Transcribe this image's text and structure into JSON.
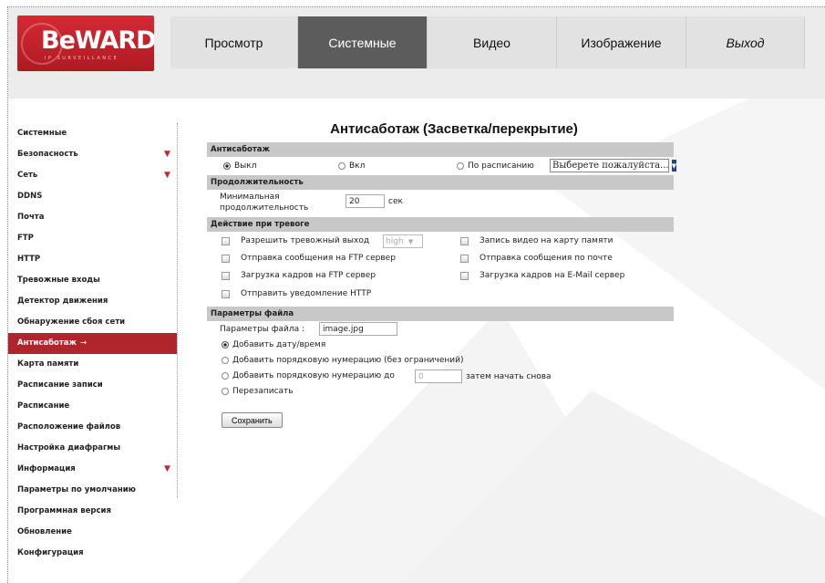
{
  "brand": {
    "name": "BeWARD",
    "tagline": "IP SURVEILLANCE"
  },
  "nav": [
    {
      "label": "Просмотр",
      "active": false
    },
    {
      "label": "Системные",
      "active": true
    },
    {
      "label": "Видео",
      "active": false
    },
    {
      "label": "Изображение",
      "active": false
    },
    {
      "label": "Выход",
      "active": false
    }
  ],
  "sidebar": [
    {
      "label": "Системные"
    },
    {
      "label": "Безопасность",
      "expand": true
    },
    {
      "label": "Сеть",
      "expand": true
    },
    {
      "label": "DDNS"
    },
    {
      "label": "Почта"
    },
    {
      "label": "FTP"
    },
    {
      "label": "HTTP"
    },
    {
      "label": "Тревожные входы"
    },
    {
      "label": "Детектор движения"
    },
    {
      "label": "Обнаружение сбоя сети"
    },
    {
      "label": "Антисаботаж",
      "active": true
    },
    {
      "label": "Карта памяти"
    },
    {
      "label": "Расписание записи"
    },
    {
      "label": "Расписание"
    },
    {
      "label": "Расположение файлов"
    },
    {
      "label": "Настройка диафрагмы"
    },
    {
      "label": "Информация",
      "expand": true
    },
    {
      "label": "Параметры по умолчанию"
    },
    {
      "label": "Программная версия"
    },
    {
      "label": "Обновление"
    },
    {
      "label": "Конфигурация"
    }
  ],
  "page": {
    "title": "Антисаботаж (Засветка/перекрытие)",
    "tamper": {
      "heading": "Антисаботаж",
      "off_label": "Выкл",
      "on_label": "Вкл",
      "schedule_label": "По расписанию",
      "schedule_select": "Выберете пожалуйста..."
    },
    "duration": {
      "heading": "Продолжительность",
      "label_line1": "Минимальная",
      "label_line2": "продолжительность",
      "value": "20",
      "unit": "сек"
    },
    "alarm": {
      "heading": "Действие при тревоге",
      "allow_output": "Разрешить тревожный выход",
      "output_level": "high",
      "record_sd": "Запись видео на карту памяти",
      "ftp_message": "Отправка сообщения на FTP сервер",
      "mail_message": "Отправка сообщения по почте",
      "ftp_upload": "Загрузка кадров на FTP сервер",
      "email_upload": "Загрузка кадров на E-Mail сервер",
      "http_notify": "Отправить уведомление HTTP"
    },
    "file": {
      "heading": "Параметры файла",
      "name_label": "Параметры файла :",
      "name_value": "image.jpg",
      "opt_datetime": "Добавить дату/время",
      "opt_seq_unlimited": "Добавить порядковую нумерацию (без ограничений)",
      "opt_seq_upto": "Добавить порядковую нумерацию до",
      "seq_upto_value": "0",
      "opt_seq_restart": "затем начать снова",
      "opt_overwrite": "Перезаписать"
    },
    "save_label": "Сохранить"
  }
}
